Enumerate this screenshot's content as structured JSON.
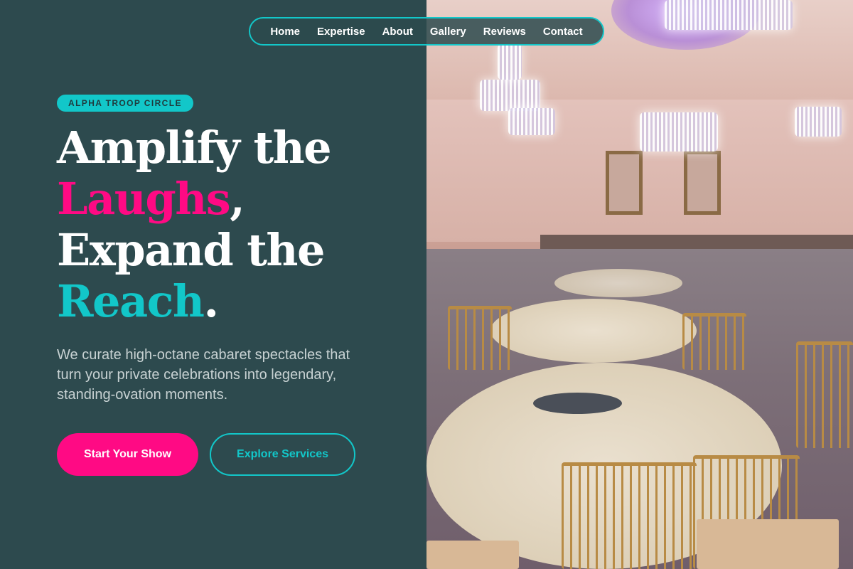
{
  "nav": {
    "items": [
      {
        "label": "Home"
      },
      {
        "label": "Expertise"
      },
      {
        "label": "About"
      },
      {
        "label": "Gallery"
      },
      {
        "label": "Reviews"
      },
      {
        "label": "Contact"
      }
    ]
  },
  "hero": {
    "badge": "ALPHA TROOP CIRCLE",
    "headline": {
      "line1": "Amplify the",
      "line2_highlight": "Laughs",
      "line2_suffix": ",",
      "line3": "Expand the",
      "line4_highlight": "Reach",
      "line4_suffix": "."
    },
    "subtitle": "We curate high-octane cabaret spectacles that turn your private celebrations into legendary, standing-ovation moments.",
    "primary_button": "Start Your Show",
    "secondary_button": "Explore Services"
  },
  "image": {
    "subject": "ballroom-photo"
  },
  "colors": {
    "background": "#2d4a4e",
    "accent_pink": "#ff0a84",
    "accent_teal": "#12c7c9",
    "text_light": "#c8d2d3"
  }
}
